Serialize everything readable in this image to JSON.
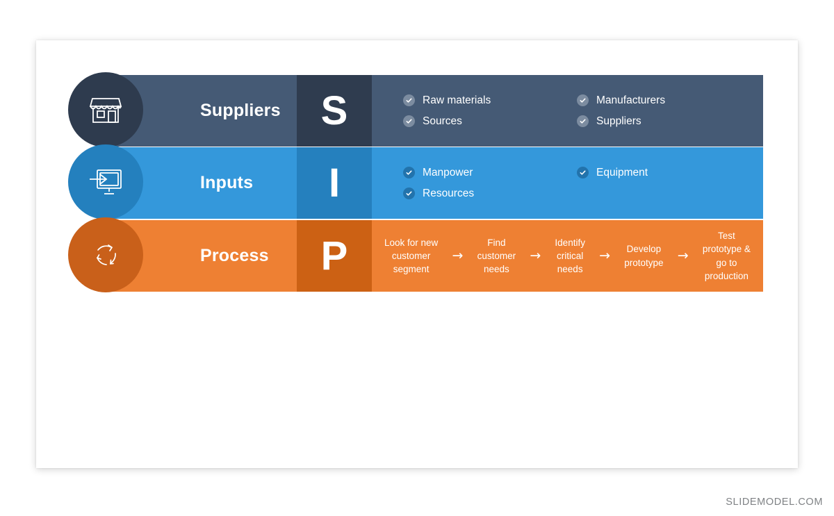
{
  "slide": {
    "watermark": "SLIDEMODEL.COM"
  },
  "colors": {
    "suppliers_bar": "#455A75",
    "suppliers_circle": "#2E3B4E",
    "suppliers_letter_cell": "#2F3C4F",
    "inputs_bar": "#3498DB",
    "inputs_circle": "#2480BE",
    "inputs_letter_cell": "#2580BE",
    "process_bar": "#EE8033",
    "process_circle": "#C9601A",
    "process_letter_cell": "#CC6114",
    "text_white": "#FFFFFF",
    "watermark": "#7F8285"
  },
  "rows": [
    {
      "key": "suppliers",
      "letter": "S",
      "title": "Suppliers",
      "icon": "storefront-icon",
      "content_type": "checklist",
      "items": [
        "Raw materials",
        "Manufacturers",
        "Sources",
        "Suppliers"
      ]
    },
    {
      "key": "inputs",
      "letter": "I",
      "title": "Inputs",
      "icon": "monitor-input-icon",
      "content_type": "checklist",
      "items": [
        "Manpower",
        "Equipment",
        "Resources"
      ]
    },
    {
      "key": "process",
      "letter": "P",
      "title": "Process",
      "icon": "cycle-arrows-icon",
      "content_type": "steps",
      "arrow_glyph": "→",
      "steps": [
        "Look for new\ncustomer\nsegment",
        "Find\ncustomer\nneeds",
        "Identify\ncritical\nneeds",
        "Develop\nprototype",
        "Test\nprototype &\ngo to\nproduction"
      ]
    }
  ]
}
